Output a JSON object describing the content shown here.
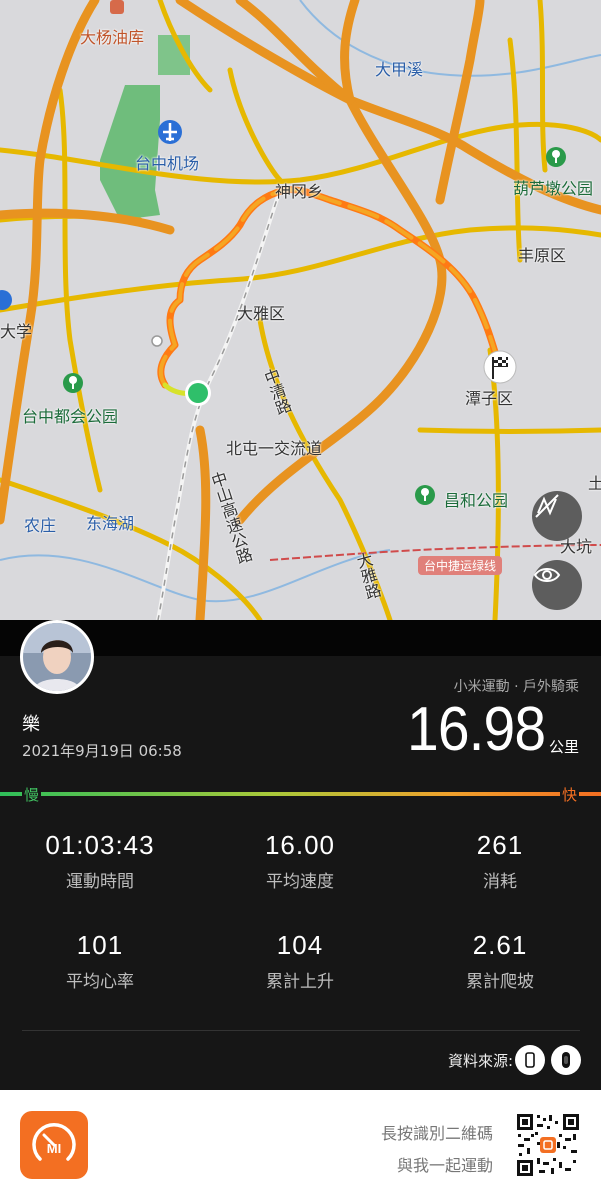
{
  "map": {
    "labels": {
      "warehouse": "大杨油库",
      "airport": "台中机场",
      "river": "大甲溪",
      "shengang": "神冈乡",
      "hulu_park": "葫芦墩公园",
      "fengyuan": "丰原区",
      "daya": "大雅区",
      "university": "大学",
      "metro_park": "台中都会公园",
      "zhongqing": "中清路",
      "tanzi": "潭子区",
      "beitun": "北屯一交流道",
      "zhongshan_hwy": "中山高速公路",
      "changhe_park": "昌和公园",
      "daya_road": "大雅路",
      "nongzhuang": "农庄",
      "donghai": "东海湖",
      "metro_line": "台中捷运绿线",
      "dakeng": "大坑",
      "tu": "土"
    }
  },
  "activity": {
    "user_name": "樂",
    "datetime": "2021年9月19日 06:58",
    "source": "小米運動 · 戶外騎乘",
    "distance": "16.98",
    "distance_unit": "公里",
    "speed_scale": {
      "slow": "慢",
      "fast": "快"
    },
    "stats": [
      {
        "value": "01:03:43",
        "label": "運動時間"
      },
      {
        "value": "16.00",
        "label": "平均速度"
      },
      {
        "value": "261",
        "label": "消耗"
      },
      {
        "value": "101",
        "label": "平均心率"
      },
      {
        "value": "104",
        "label": "累計上升"
      },
      {
        "value": "2.61",
        "label": "累計爬坡"
      }
    ],
    "data_source_label": "資料來源:"
  },
  "footer": {
    "line1": "長按識別二維碼",
    "line2": "與我一起運動",
    "logo_text": "MI"
  },
  "colors": {
    "accent": "#f36f22",
    "slow": "#2fbf5a",
    "route": "#f5a623",
    "panel_bg": "#161616"
  },
  "icons": [
    "airport-icon",
    "park-icon",
    "finish-flag-icon",
    "start-dot-icon",
    "hide-route-icon",
    "view-eye-icon",
    "phone-icon",
    "band-icon",
    "mi-logo-icon",
    "qr-code-icon"
  ]
}
